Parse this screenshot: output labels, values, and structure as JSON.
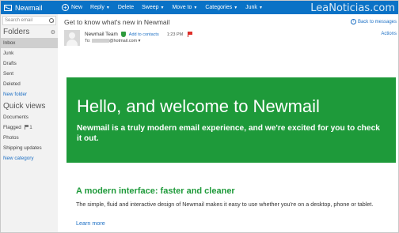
{
  "app": {
    "name": "Newmail"
  },
  "watermark": "LeaNoticias.com",
  "toolbar": {
    "new": "New",
    "reply": "Reply",
    "delete": "Delete",
    "sweep": "Sweep",
    "move_to": "Move to",
    "categories": "Categories",
    "junk": "Junk"
  },
  "sidebar": {
    "search_placeholder": "Search email",
    "folders_heading": "Folders",
    "folders": [
      {
        "label": "Inbox"
      },
      {
        "label": "Junk"
      },
      {
        "label": "Drafts"
      },
      {
        "label": "Sent"
      },
      {
        "label": "Deleted"
      }
    ],
    "new_folder": "New folder",
    "quick_views_heading": "Quick views",
    "quick_views": [
      {
        "label": "Documents",
        "count": ""
      },
      {
        "label": "Flagged",
        "count": "1"
      },
      {
        "label": "Photos",
        "count": ""
      },
      {
        "label": "Shipping updates",
        "count": ""
      }
    ],
    "new_category": "New category"
  },
  "message": {
    "subject": "Get to know what's new in Newmail",
    "back": "Back to messages",
    "actions": "Actions",
    "sender": "Newmail Team",
    "add_to_contacts": "Add to contacts",
    "time": "1:23 PM",
    "to_label": "To:",
    "to_address": "@hotmail.com",
    "banner_title": "Hello, and welcome to Newmail",
    "banner_text": "Newmail is a truly modern email experience, and we're excited for you to check it out.",
    "section_heading": "A modern interface: faster and cleaner",
    "section_text": "The simple, fluid and interactive design of Newmail makes it easy to use whether you're on a desktop, phone or tablet.",
    "learn_more": "Learn more"
  },
  "colors": {
    "topbar": "#0a72c6",
    "banner": "#1e9a3a",
    "link": "#1c6fc4",
    "sidebar_bg": "#f2f2f2"
  }
}
